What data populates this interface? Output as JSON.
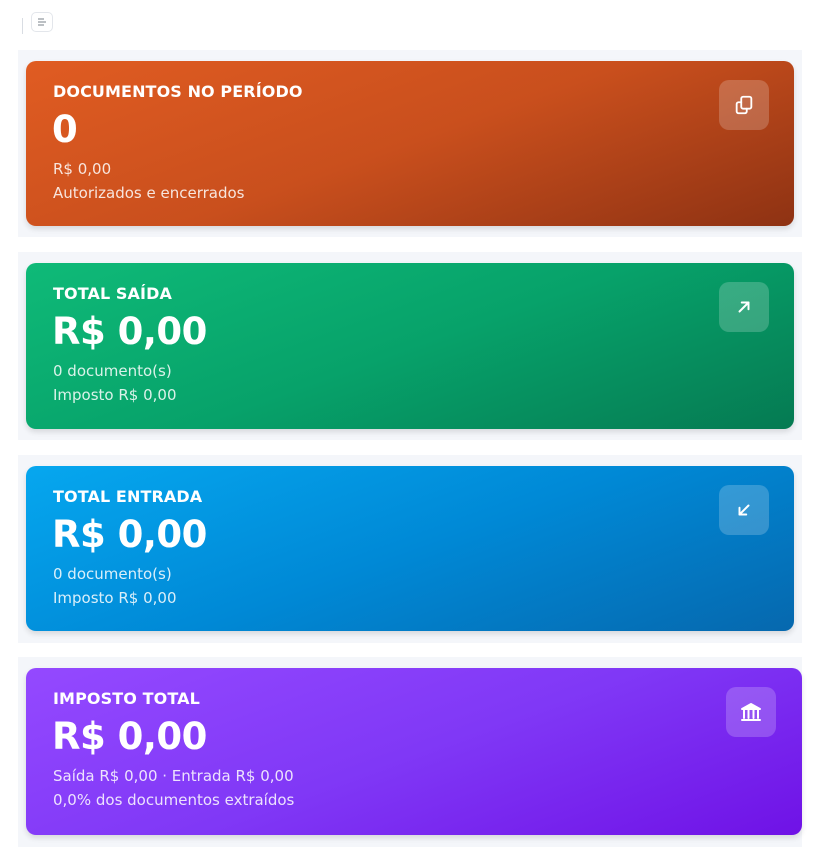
{
  "toolbar": {
    "menu_icon": "list-icon"
  },
  "cards": [
    {
      "title": "DOCUMENTOS NO PERÍODO",
      "value": "0",
      "line1": "R$ 0,00",
      "line2": "Autorizados e encerrados",
      "icon": "copy-icon",
      "color": "#d2531f"
    },
    {
      "title": "TOTAL SAÍDA",
      "value": "R$ 0,00",
      "line1": "0 documento(s)",
      "line2": "Imposto R$ 0,00",
      "icon": "arrow-up-right-icon",
      "color": "#07a26a"
    },
    {
      "title": "TOTAL ENTRADA",
      "value": "R$ 0,00",
      "line1": "0 documento(s)",
      "line2": "Imposto R$ 0,00",
      "icon": "arrow-down-left-icon",
      "color": "#0089d6"
    },
    {
      "title": "IMPOSTO TOTAL",
      "value": "R$ 0,00",
      "line1": "Saída R$ 0,00 · Entrada R$ 0,00",
      "line2": "0,0% dos documentos extraídos",
      "icon": "bank-icon",
      "color": "#8038f6"
    }
  ]
}
